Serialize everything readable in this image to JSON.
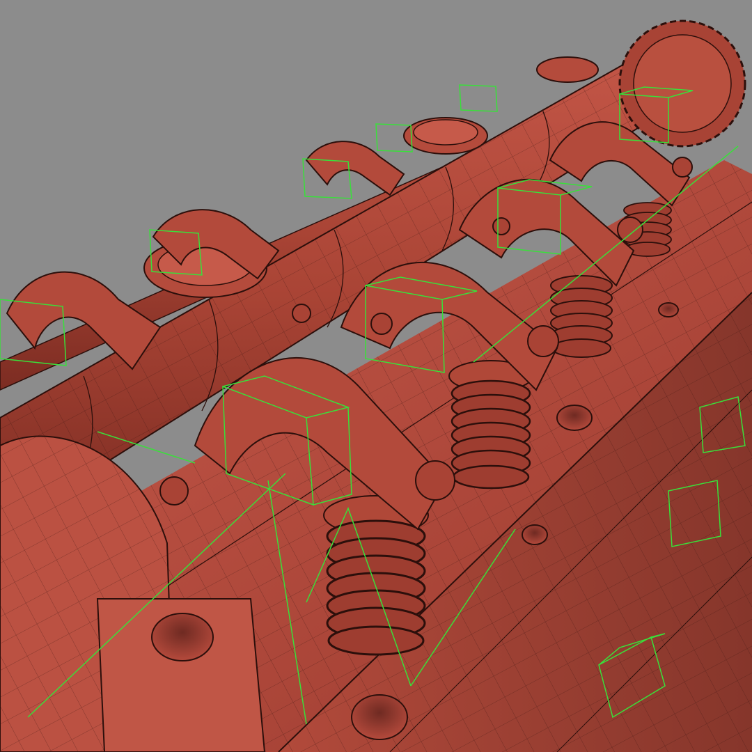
{
  "viewport": {
    "background_color": "#8c8c8c",
    "shading_mode": "wireframe-on-shaded",
    "model_color": "#b54a3c",
    "wire_color": "#3a1410",
    "bounding_box_color": "#39e03a"
  },
  "scene": {
    "cylinder_count": 6
  }
}
